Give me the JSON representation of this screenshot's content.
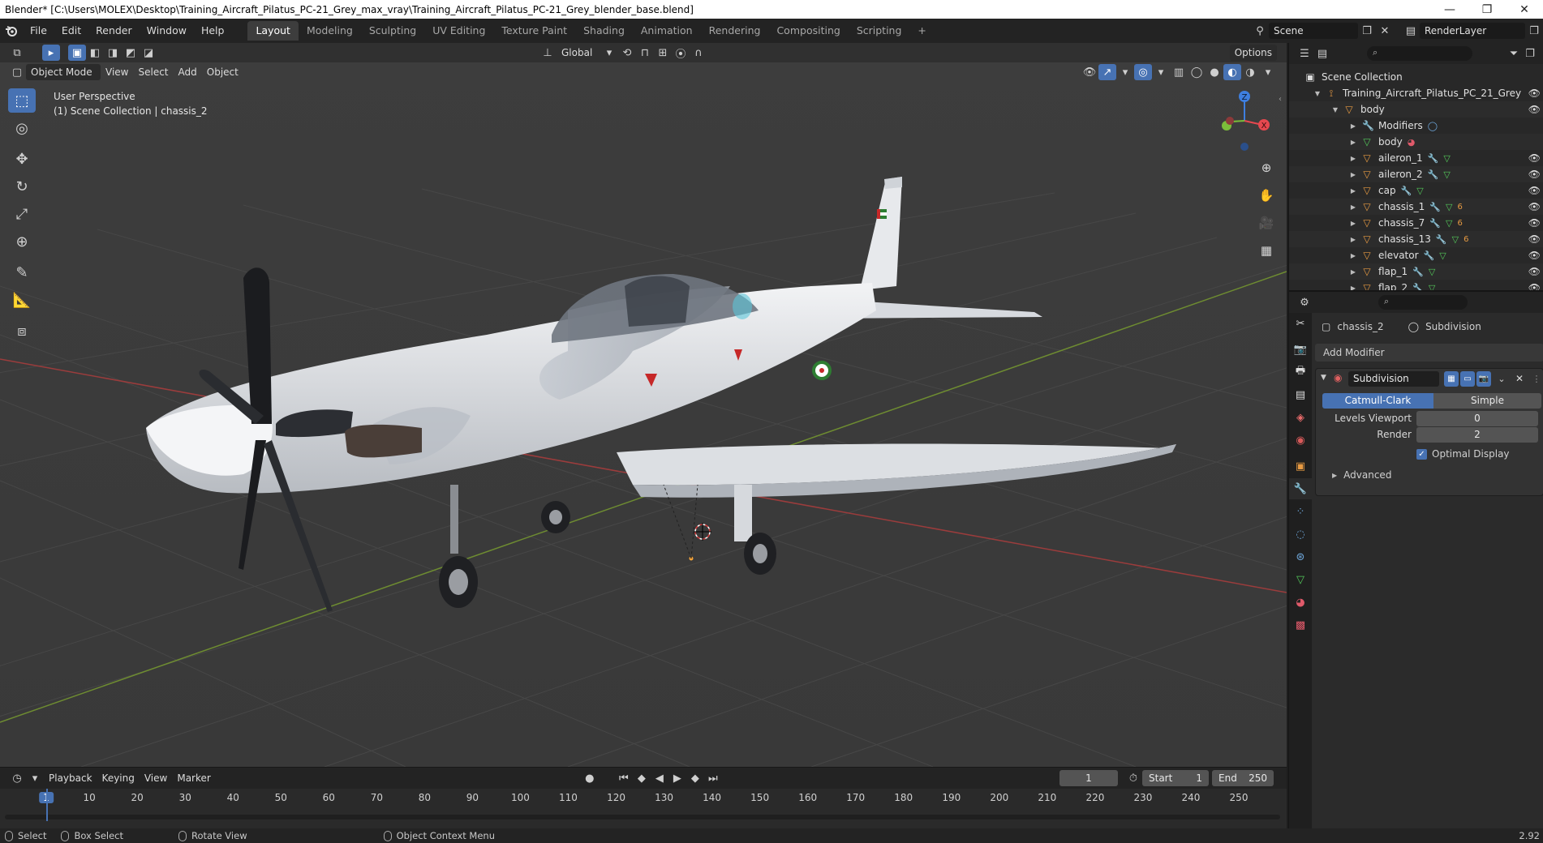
{
  "window": {
    "title": "Blender* [C:\\Users\\MOLEX\\Desktop\\Training_Aircraft_Pilatus_PC-21_Grey_max_vray\\Training_Aircraft_Pilatus_PC-21_Grey_blender_base.blend]",
    "minimize": "—",
    "restore": "❐",
    "close": "✕"
  },
  "menu": [
    "File",
    "Edit",
    "Render",
    "Window",
    "Help"
  ],
  "workspaces": [
    {
      "label": "Layout",
      "active": true
    },
    {
      "label": "Modeling"
    },
    {
      "label": "Sculpting"
    },
    {
      "label": "UV Editing"
    },
    {
      "label": "Texture Paint"
    },
    {
      "label": "Shading"
    },
    {
      "label": "Animation"
    },
    {
      "label": "Rendering"
    },
    {
      "label": "Compositing"
    },
    {
      "label": "Scripting"
    }
  ],
  "add_workspace": "+",
  "scene": {
    "name": "Scene",
    "layer": "RenderLayer"
  },
  "viewport": {
    "transform_orientation": "Global",
    "options": "Options",
    "mode": "Object Mode",
    "menus": [
      "View",
      "Select",
      "Add",
      "Object"
    ],
    "info_line1": "User Perspective",
    "info_line2": "(1) Scene Collection | chassis_2",
    "gizmo": {
      "x": "X",
      "y": "Y",
      "z": "Z"
    }
  },
  "outliner": {
    "root": "Scene Collection",
    "rows": [
      {
        "label": "Training_Aircraft_Pilatus_PC_21_Grey",
        "indent": 1,
        "type": "empty",
        "open": true
      },
      {
        "label": "body",
        "indent": 2,
        "type": "mesh",
        "open": true
      },
      {
        "label": "Modifiers",
        "indent": 3,
        "type": "modifier"
      },
      {
        "label": "body",
        "indent": 3,
        "type": "data"
      },
      {
        "label": "aileron_1",
        "indent": 3,
        "type": "mesh"
      },
      {
        "label": "aileron_2",
        "indent": 3,
        "type": "mesh"
      },
      {
        "label": "cap",
        "indent": 3,
        "type": "mesh"
      },
      {
        "label": "chassis_1",
        "indent": 3,
        "type": "mesh",
        "badge": "6"
      },
      {
        "label": "chassis_7",
        "indent": 3,
        "type": "mesh",
        "badge": "6"
      },
      {
        "label": "chassis_13",
        "indent": 3,
        "type": "mesh",
        "badge": "6"
      },
      {
        "label": "elevator",
        "indent": 3,
        "type": "mesh"
      },
      {
        "label": "flap_1",
        "indent": 3,
        "type": "mesh"
      },
      {
        "label": "flap_2",
        "indent": 3,
        "type": "mesh"
      }
    ]
  },
  "properties": {
    "object_name": "chassis_2",
    "modifier_breadcrumb": "Subdivision",
    "add_modifier": "Add Modifier",
    "modifier": {
      "name": "Subdivision",
      "type_a": "Catmull-Clark",
      "type_b": "Simple",
      "levels_viewport_label": "Levels Viewport",
      "levels_viewport": "0",
      "render_label": "Render",
      "render": "2",
      "optimal_display": "Optimal Display",
      "advanced": "Advanced"
    }
  },
  "timeline": {
    "menus": [
      "Playback",
      "Keying",
      "View",
      "Marker"
    ],
    "current_frame": "1",
    "start_label": "Start",
    "start": "1",
    "end_label": "End",
    "end": "250",
    "ticks": [
      "1",
      "10",
      "20",
      "30",
      "40",
      "50",
      "60",
      "70",
      "80",
      "90",
      "100",
      "110",
      "120",
      "130",
      "140",
      "150",
      "160",
      "170",
      "180",
      "190",
      "200",
      "210",
      "220",
      "230",
      "240",
      "250"
    ]
  },
  "status": {
    "select": "Select",
    "box_select": "Box Select",
    "rotate_view": "Rotate View",
    "context_menu": "Object Context Menu",
    "version": "2.92"
  },
  "colors": {
    "accent": "#4772b3",
    "object_orange": "#e69a42",
    "data_green": "#53c95a",
    "modifier_blue": "#6fa8dc",
    "axis_x": "#e6484f",
    "axis_y": "#7bbd3a",
    "axis_z": "#3e7fe0"
  }
}
